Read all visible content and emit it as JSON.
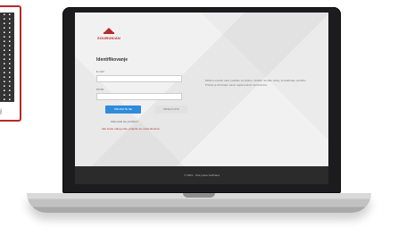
{
  "qr": {
    "caption": "ej"
  },
  "screen": {
    "logo_text": "SOUBUNIAN",
    "title": "Identifikovanje",
    "fields": [
      {
        "label": "E-mail",
        "value": ""
      },
      {
        "label": "Pin/ID",
        "value": ""
      }
    ],
    "buttons": {
      "primary": "PRIJAVITE SE",
      "secondary": "RESETUJTE"
    },
    "links": {
      "forgot": "Zaboravili ste pin/šifru?",
      "register": "Ako imate nalog ovde, prijavite se: www.domena"
    },
    "note": "Molimo unesite vaše podatke za prijavu. Ukoliko nemate nalog, kontaktirajte podršku. Pristup je dozvoljen samo registrovanim korisnicima.",
    "footer": "© 2024 – Sva prava zadržana"
  }
}
